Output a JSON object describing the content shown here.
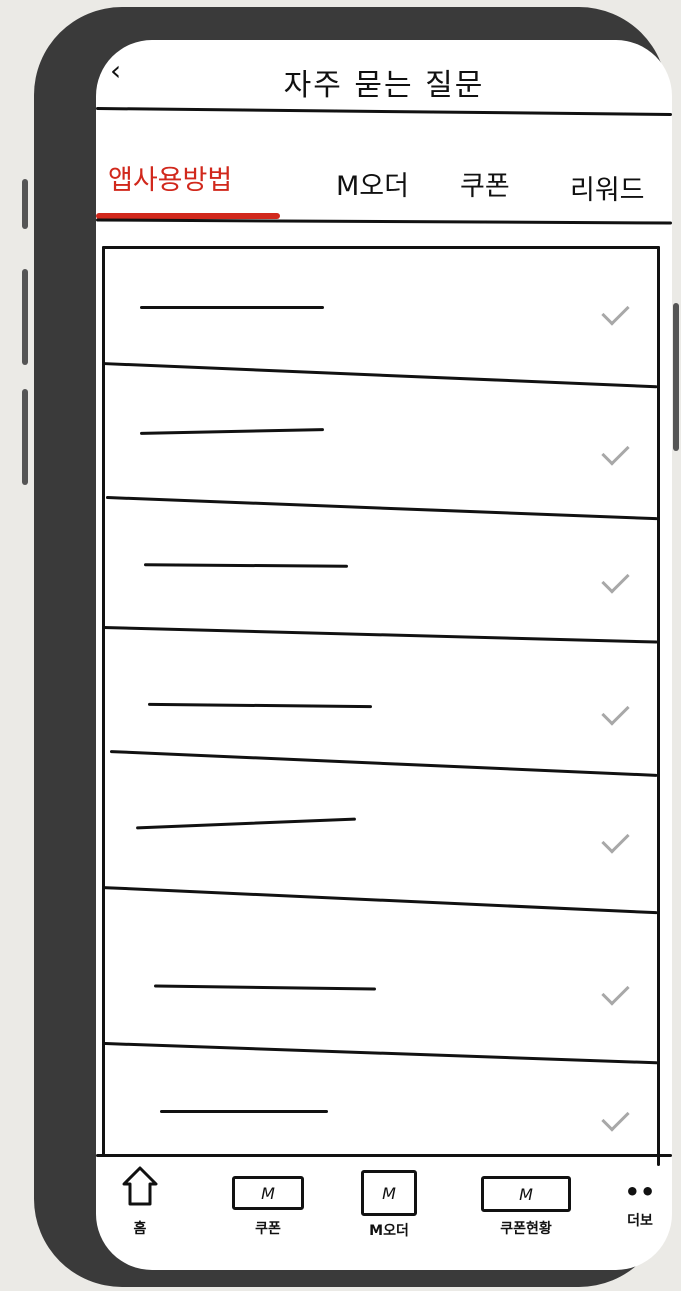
{
  "header": {
    "back_label": "‹",
    "title": "자주 묻는 질문"
  },
  "tabs": [
    {
      "label": "앱사용방법",
      "active": true
    },
    {
      "label": "M오더",
      "active": false
    },
    {
      "label": "쿠폰",
      "active": false
    },
    {
      "label": "리워드",
      "active": false
    }
  ],
  "faq_items": [
    {
      "expand_icon": "chevron-down-icon"
    },
    {
      "expand_icon": "chevron-down-icon"
    },
    {
      "expand_icon": "chevron-down-icon"
    },
    {
      "expand_icon": "chevron-down-icon"
    },
    {
      "expand_icon": "chevron-down-icon"
    },
    {
      "expand_icon": "chevron-down-icon"
    },
    {
      "expand_icon": "chevron-down-icon"
    }
  ],
  "bottom_nav": {
    "home": {
      "label": "홈",
      "icon": "house-icon",
      "glyph": ""
    },
    "coupon": {
      "label": "쿠폰",
      "icon": "coupon-icon",
      "glyph": "M"
    },
    "mpay": {
      "label": "M오더",
      "icon": "bag-icon",
      "glyph": "M"
    },
    "coupon_status": {
      "label": "쿠폰현황",
      "icon": "ticket-icon",
      "glyph": "M"
    },
    "more": {
      "label": "더보",
      "icon": "more-dots-icon",
      "glyph": "••"
    }
  },
  "colors": {
    "accent": "#d1281c",
    "frame": "#3a3a3a",
    "background": "#ebeae6",
    "check": "#a8a8a8"
  }
}
